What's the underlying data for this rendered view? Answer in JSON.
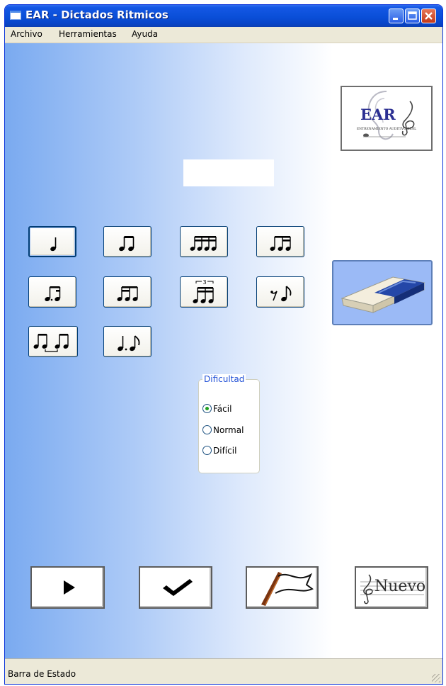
{
  "window": {
    "title": "EAR - Dictados Ritmicos",
    "controls": [
      "minimize",
      "maximize",
      "close"
    ]
  },
  "menu": {
    "items": [
      "Archivo",
      "Herramientas",
      "Ayuda"
    ]
  },
  "logo": {
    "text": "EAR",
    "caption": "ENTRENAMIENTO AUDITIVO REAL"
  },
  "rhythm_buttons": [
    {
      "name": "quarter-note",
      "symbol": "♩"
    },
    {
      "name": "two-eighths",
      "symbol": "♫"
    },
    {
      "name": "four-sixteenths",
      "symbol": "𝅘𝅥𝅯𝅘𝅥𝅯𝅘𝅥𝅯𝅘𝅥𝅯"
    },
    {
      "name": "eighth-two-sixteenths",
      "symbol": "𝅘𝅥𝅮𝅘𝅥𝅯𝅘𝅥𝅯"
    },
    {
      "name": "dotted-eighth-sixteenth",
      "symbol": "𝅘𝅥𝅮.𝅘𝅥𝅯"
    },
    {
      "name": "two-sixteenths-eighth",
      "symbol": "𝅘𝅥𝅯𝅘𝅥𝅯𝅘𝅥𝅮"
    },
    {
      "name": "triplet",
      "symbol": "3"
    },
    {
      "name": "eighth-rest-eighth",
      "symbol": "𝄾♪"
    },
    {
      "name": "syncopation",
      "symbol": "♫♫"
    },
    {
      "name": "dotted-quarter-eighth",
      "symbol": "♩.♪"
    }
  ],
  "difficulty": {
    "label": "Dificultad",
    "options": [
      {
        "label": "Fácil",
        "checked": true
      },
      {
        "label": "Normal",
        "checked": false
      },
      {
        "label": "Difícil",
        "checked": false
      }
    ]
  },
  "actions": {
    "play": "play-icon",
    "check": "check-icon",
    "flag": "flag-icon",
    "new": "Nuevo"
  },
  "status": {
    "text": "Barra de Estado"
  },
  "colors": {
    "titlebar": "#0A4FD8",
    "content_gradient_left": "#7AAAF0",
    "eraser_button": "#9BBAF6",
    "group_legend": "#1F4FD6",
    "radio_checked": "#21A121"
  }
}
